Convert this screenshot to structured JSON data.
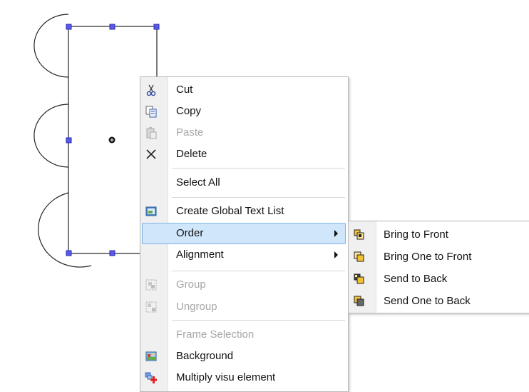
{
  "context_menu": {
    "items": [
      {
        "label": "Cut",
        "icon": "scissors-icon",
        "enabled": true
      },
      {
        "label": "Copy",
        "icon": "copy-icon",
        "enabled": true
      },
      {
        "label": "Paste",
        "icon": "paste-icon",
        "enabled": false
      },
      {
        "label": "Delete",
        "icon": "delete-x-icon",
        "enabled": true
      },
      {
        "label": "Select All",
        "enabled": true
      },
      {
        "label": "Create Global Text List",
        "icon": "text-list-icon",
        "enabled": true
      },
      {
        "label": "Order",
        "enabled": true,
        "highlighted": true,
        "has_submenu": true
      },
      {
        "label": "Alignment",
        "enabled": true,
        "has_submenu": true
      },
      {
        "label": "Group",
        "icon": "group-icon",
        "enabled": false
      },
      {
        "label": "Ungroup",
        "icon": "ungroup-icon",
        "enabled": false
      },
      {
        "label": "Frame Selection",
        "enabled": false
      },
      {
        "label": "Background",
        "icon": "background-image-icon",
        "enabled": true
      },
      {
        "label": "Multiply visu element",
        "icon": "multiply-element-icon",
        "enabled": true
      }
    ]
  },
  "submenu": {
    "items": [
      {
        "label": "Bring to Front",
        "icon": "bring-to-front-icon"
      },
      {
        "label": "Bring One to Front",
        "icon": "bring-forward-icon"
      },
      {
        "label": "Send to Back",
        "icon": "send-to-back-icon"
      },
      {
        "label": "Send One to Back",
        "icon": "send-backward-icon"
      }
    ]
  },
  "colors": {
    "highlight_bg": "#cfe6fb",
    "highlight_border": "#7fb4e6",
    "selection_handle": "#3b3bd9",
    "disabled_text": "#a7a7a7"
  }
}
